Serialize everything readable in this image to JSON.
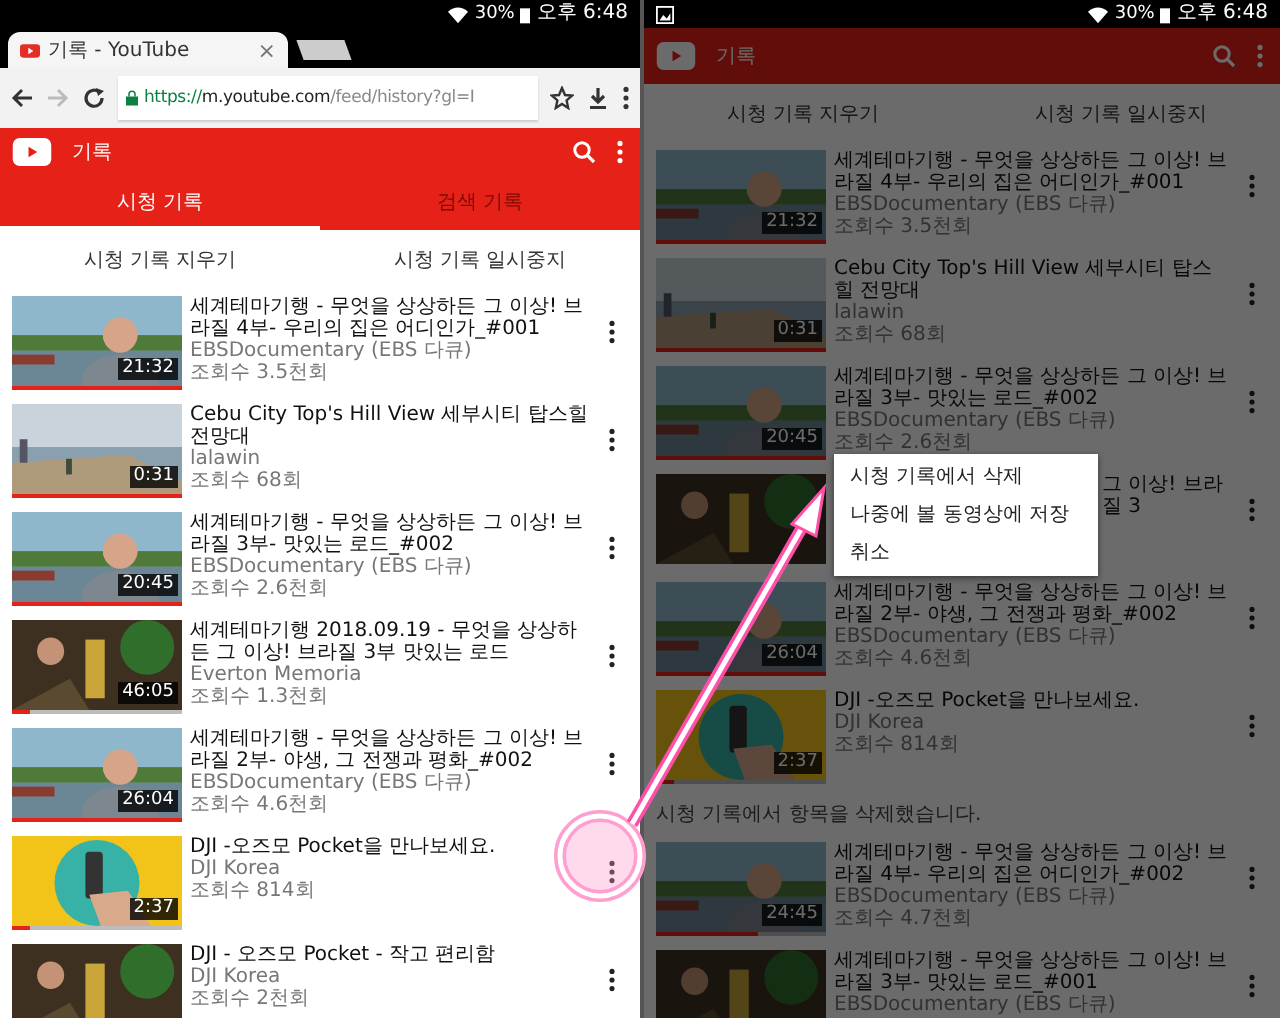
{
  "left": {
    "status_bar": {
      "battery": "30%",
      "time": "오후 6:48"
    },
    "browser_tab": {
      "title": "기록 - YouTube",
      "close": "×"
    },
    "address_bar": {
      "scheme": "https://",
      "host": "m.youtube.com",
      "path": "/feed/history?gl=I",
      "forward_disabled": true
    },
    "header": {
      "title": "기록"
    },
    "tabs": [
      {
        "label": "시청 기록",
        "selected": true
      },
      {
        "label": "검색 기록",
        "selected": false
      }
    ],
    "actions": [
      "시청 기록 지우기",
      "시청 기록 일시중지"
    ],
    "list": [
      {
        "kind": "video",
        "title": "세계테마기행 - 무엇을 상상하든 그 이상! 브라질 4부- 우리의 집은 어디인가_#001",
        "channel": "EBSDocumentary (EBS 다큐)",
        "views": "조회수 3.5천회",
        "duration": "21:32",
        "level": 1
      },
      {
        "kind": "video",
        "title": "Cebu City Top's Hill View 세부시티 탑스힐 전망대",
        "channel": "lalawin",
        "views": "조회수 68회",
        "duration": "0:31",
        "level": 1
      },
      {
        "kind": "video",
        "title": "세계테마기행 - 무엇을 상상하든 그 이상! 브라질 3부- 맛있는 로드_#002",
        "channel": "EBSDocumentary (EBS 다큐)",
        "views": "조회수 2.6천회",
        "duration": "20:45",
        "level": 1
      },
      {
        "kind": "video",
        "title": "세계테마기행 2018.09.19 - 무엇을 상상하든 그 이상! 브라질 3부 맛있는 로드",
        "channel": "Everton Memoria",
        "views": "조회수 1.3천회",
        "duration": "46:05",
        "level": 0.1
      },
      {
        "kind": "video",
        "title": "세계테마기행 - 무엇을 상상하든 그 이상! 브라질 2부- 야생, 그 전쟁과 평화_#002",
        "channel": "EBSDocumentary (EBS 다큐)",
        "views": "조회수 4.6천회",
        "duration": "26:04",
        "level": 1
      },
      {
        "kind": "video",
        "title": "DJI -오즈모 Pocket을 만나보세요.",
        "channel": "DJI Korea",
        "views": "조회수 814회",
        "duration": "2:37",
        "level": 0.1
      },
      {
        "kind": "video",
        "title": "DJI - 오즈모 Pocket - 작고 편리함",
        "channel": "DJI Korea",
        "views": "조회수 2천회"
      }
    ]
  },
  "right": {
    "status_bar": {
      "battery": "30%",
      "time": "오후 6:48"
    },
    "header": {
      "title": "기록"
    },
    "actions": [
      "시청 기록 지우기",
      "시청 기록 일시중지"
    ],
    "list": [
      {
        "kind": "video",
        "title": "세계테마기행 - 무엇을 상상하든 그 이상! 브라질 4부- 우리의 집은 어디인가_#001",
        "channel": "EBSDocumentary (EBS 다큐)",
        "views": "조회수 3.5천회",
        "duration": "21:32",
        "level": 1
      },
      {
        "kind": "video",
        "title": "Cebu City Top's Hill View 세부시티 탑스힐 전망대",
        "channel": "lalawin",
        "views": "조회수 68회",
        "duration": "0:31",
        "level": 1
      },
      {
        "kind": "video",
        "title": "세계테마기행 - 무엇을 상상하든 그 이상! 브라질 3부- 맛있는 로드_#002",
        "channel": "EBSDocumentary (EBS 다큐)",
        "views": "조회수 2.6천회",
        "duration": "20:45",
        "level": 1
      },
      {
        "kind": "covered",
        "title": "그 이상! 브라질 3"
      },
      {
        "kind": "video",
        "title": "세계테마기행 - 무엇을 상상하든 그 이상! 브라질 2부- 야생, 그 전쟁과 평화_#002",
        "channel": "EBSDocumentary (EBS 다큐)",
        "views": "조회수 4.6천회",
        "duration": "26:04",
        "level": 1
      },
      {
        "kind": "video",
        "title": "DJI -오즈모 Pocket을 만나보세요.",
        "channel": "DJI Korea",
        "views": "조회수 814회",
        "duration": "2:37",
        "level": 0.1
      },
      {
        "kind": "notice",
        "text": "시청 기록에서 항목을 삭제했습니다."
      },
      {
        "kind": "video",
        "title": "세계테마기행 - 무엇을 상상하든 그 이상! 브라질 4부- 우리의 집은 어디인가_#002",
        "channel": "EBSDocumentary (EBS 다큐)",
        "views": "조회수 4.7천회",
        "duration": "24:45",
        "level": 0.6
      },
      {
        "kind": "video",
        "title": "세계테마기행 - 무엇을 상상하든 그 이상! 브라질 3부- 맛있는 로드_#001",
        "channel": "EBSDocumentary (EBS 다큐)"
      }
    ],
    "menu": [
      "시청 기록에서 삭제",
      "나중에 볼 동영상에 저장",
      "취소"
    ]
  }
}
